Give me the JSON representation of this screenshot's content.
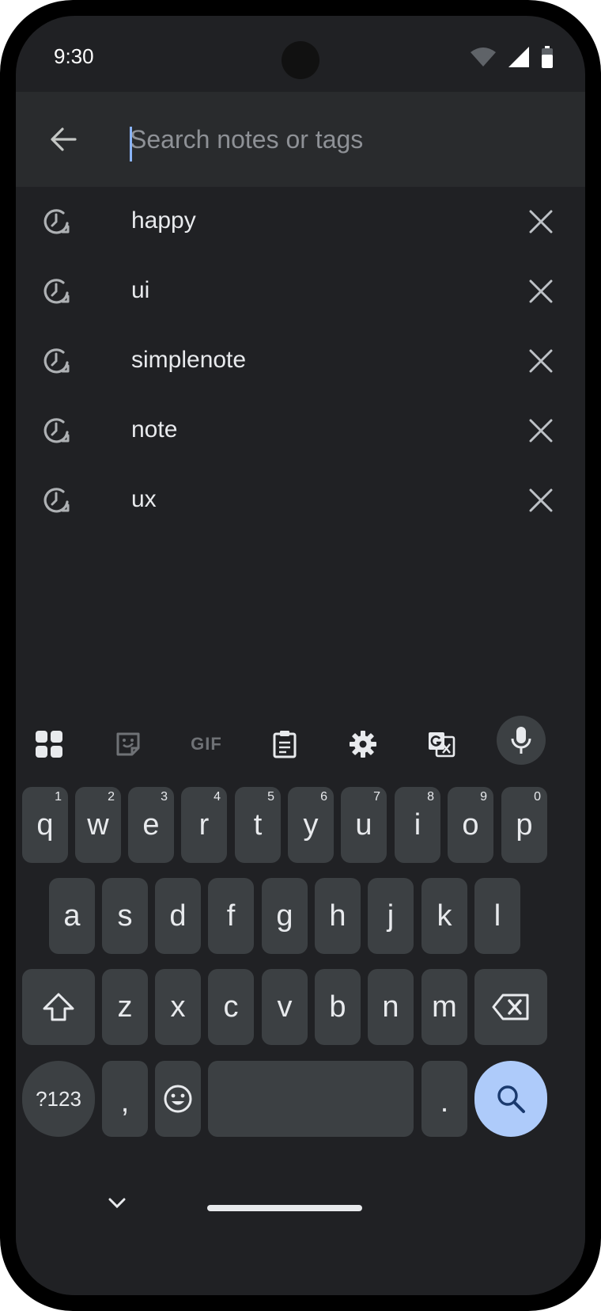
{
  "status": {
    "time": "9:30"
  },
  "search": {
    "placeholder": "Search notes or tags",
    "value": ""
  },
  "history": [
    {
      "label": "happy"
    },
    {
      "label": "ui"
    },
    {
      "label": "simplenote"
    },
    {
      "label": "note"
    },
    {
      "label": "ux"
    }
  ],
  "keyboard": {
    "toolbar": {
      "gif_label": "GIF"
    },
    "row1": [
      {
        "k": "q",
        "h": "1"
      },
      {
        "k": "w",
        "h": "2"
      },
      {
        "k": "e",
        "h": "3"
      },
      {
        "k": "r",
        "h": "4"
      },
      {
        "k": "t",
        "h": "5"
      },
      {
        "k": "y",
        "h": "6"
      },
      {
        "k": "u",
        "h": "7"
      },
      {
        "k": "i",
        "h": "8"
      },
      {
        "k": "o",
        "h": "9"
      },
      {
        "k": "p",
        "h": "0"
      }
    ],
    "row2": [
      "a",
      "s",
      "d",
      "f",
      "g",
      "h",
      "j",
      "k",
      "l"
    ],
    "row3": [
      "z",
      "x",
      "c",
      "v",
      "b",
      "n",
      "m"
    ],
    "symbols_label": "?123",
    "comma_label": ",",
    "period_label": "."
  },
  "colors": {
    "background": "#202124",
    "header": "#292b2d",
    "key": "#3c4043",
    "accent": "#8ab4f8",
    "search_key": "#aecbfa"
  },
  "icons": [
    "back-arrow-icon",
    "history-icon",
    "close-icon",
    "apps-grid-icon",
    "sticker-icon",
    "clipboard-icon",
    "gear-icon",
    "translate-icon",
    "mic-icon",
    "shift-icon",
    "backspace-icon",
    "emoji-icon",
    "search-icon",
    "chevron-down-icon",
    "wifi-icon",
    "signal-icon",
    "battery-icon"
  ]
}
